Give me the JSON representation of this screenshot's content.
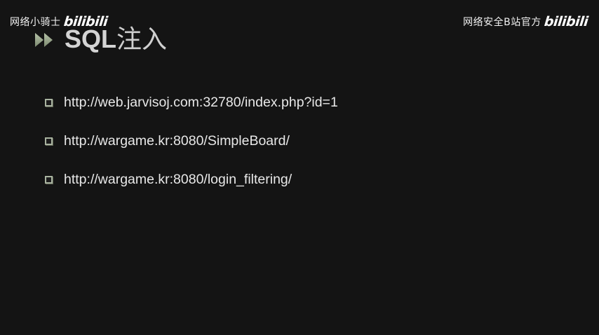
{
  "watermarks": {
    "left_text": "网络小骑士",
    "left_logo": "bilibili",
    "right_text": "网络安全B站官方",
    "right_logo": "bilibili"
  },
  "title": {
    "icon": "double-play-arrows-icon",
    "sql": "SQL",
    "rest": "注入"
  },
  "bullets": [
    {
      "text": "http://web.jarvisoj.com:32780/index.php?id=1"
    },
    {
      "text": "http://wargame.kr:8080/SimpleBoard/"
    },
    {
      "text": "http://wargame.kr:8080/login_filtering/"
    }
  ],
  "colors": {
    "background": "#141414",
    "text": "#e8e8e8",
    "title": "#cfcfcf",
    "bullet_box": "#a9b3a0",
    "arrow": "#9aa88e"
  }
}
